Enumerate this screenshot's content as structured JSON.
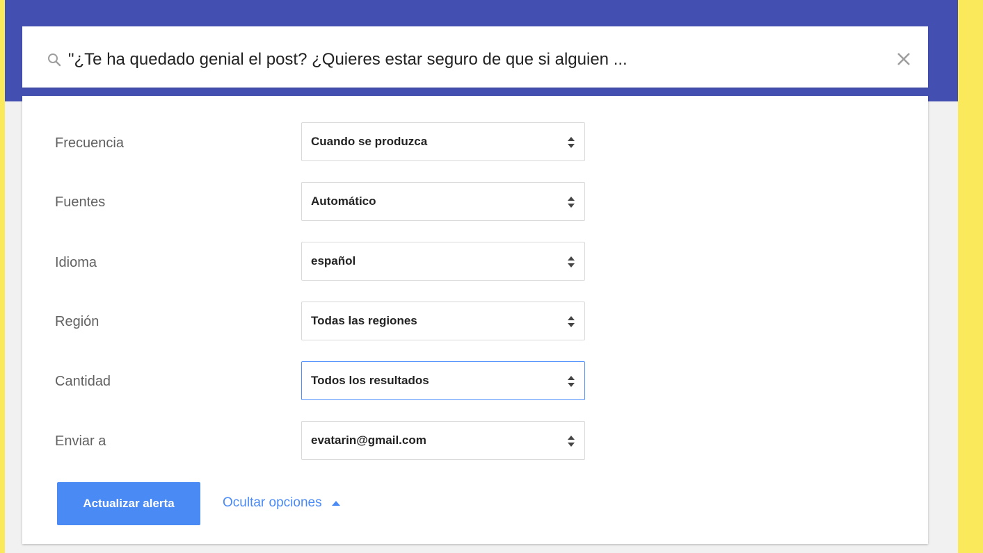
{
  "search": {
    "query": "\"¿Te ha quedado genial el post? ¿Quieres estar seguro de que si alguien ..."
  },
  "options": [
    {
      "label": "Frecuencia",
      "value": "Cuando se produzca"
    },
    {
      "label": "Fuentes",
      "value": "Automático"
    },
    {
      "label": "Idioma",
      "value": "español"
    },
    {
      "label": "Región",
      "value": "Todas las regiones"
    },
    {
      "label": "Cantidad",
      "value": "Todos los resultados"
    },
    {
      "label": "Enviar a",
      "value": "evatarin@gmail.com"
    }
  ],
  "actions": {
    "update_label": "Actualizar alerta",
    "hide_options_label": "Ocultar opciones"
  },
  "colors": {
    "header": "#4450b1",
    "accent": "#4a8af4",
    "side_bands": "#fbe95c"
  }
}
